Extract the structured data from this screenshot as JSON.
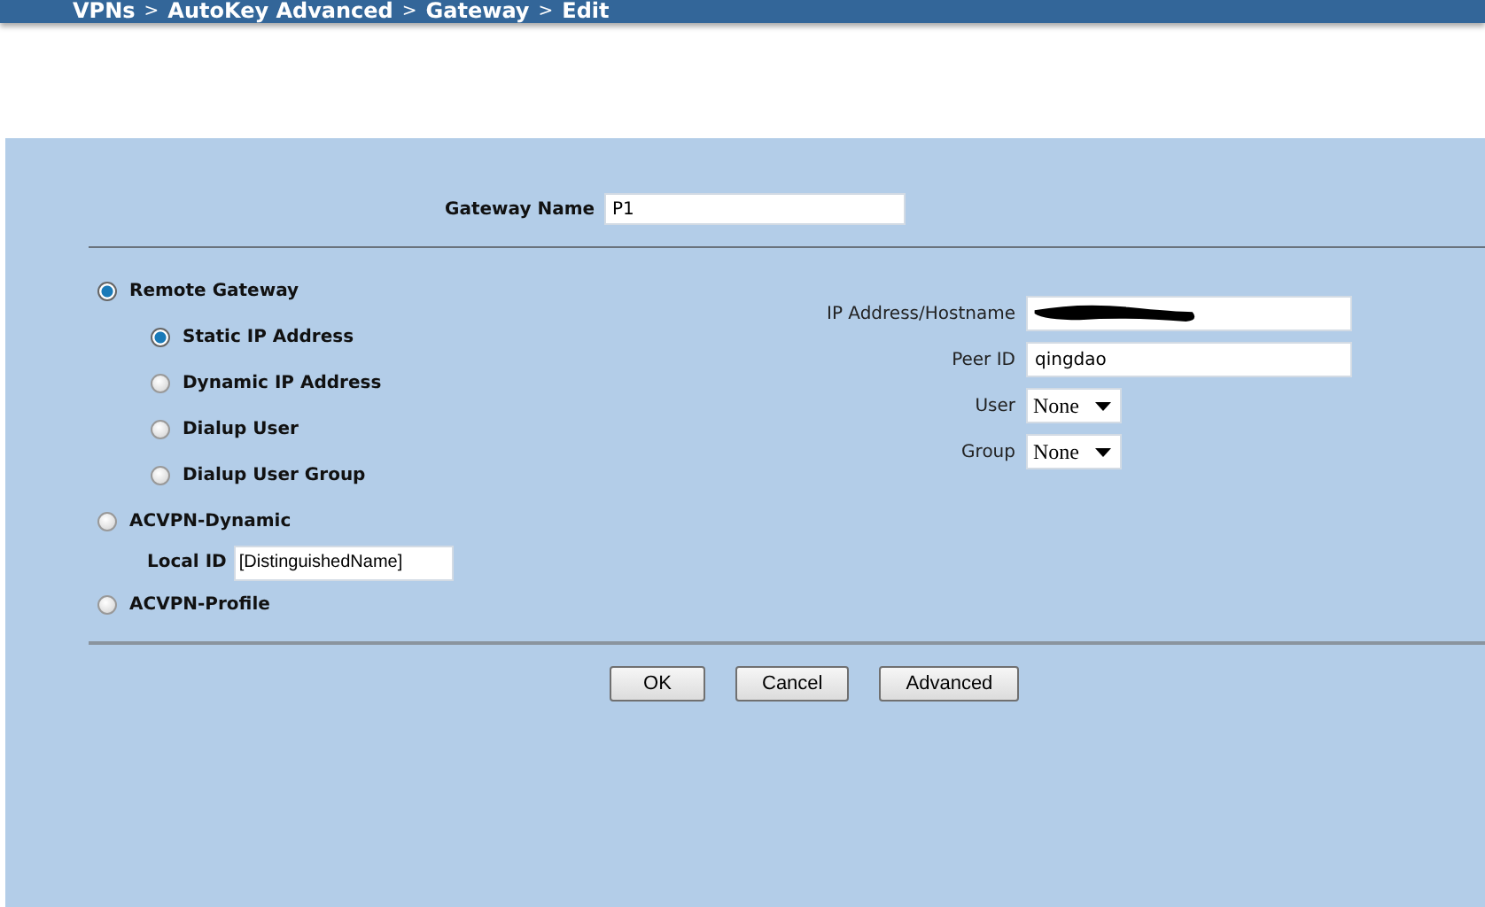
{
  "breadcrumb": {
    "items": [
      "VPNs",
      "AutoKey Advanced",
      "Gateway",
      "Edit"
    ],
    "separator": ">"
  },
  "gateway_name": {
    "label": "Gateway Name",
    "value": "P1"
  },
  "gateway_types": [
    {
      "label": "Remote Gateway",
      "selected": true,
      "options": [
        {
          "label": "Static IP Address",
          "selected": true
        },
        {
          "label": "Dynamic IP Address",
          "selected": false
        },
        {
          "label": "Dialup User",
          "selected": false
        },
        {
          "label": "Dialup User Group",
          "selected": false
        }
      ]
    },
    {
      "label": "ACVPN-Dynamic",
      "selected": false,
      "local_id": {
        "label": "Local ID",
        "value": "[DistinguishedName]"
      }
    },
    {
      "label": "ACVPN-Profile",
      "selected": false
    }
  ],
  "remote_fields": [
    {
      "label": "IP Address/Hostname",
      "kind": "redacted"
    },
    {
      "label": "Peer ID",
      "kind": "text",
      "value": "qingdao"
    },
    {
      "label": "User",
      "kind": "select",
      "value": "None"
    },
    {
      "label": "Group",
      "kind": "select",
      "value": "None"
    }
  ],
  "buttons": [
    "OK",
    "Cancel",
    "Advanced"
  ]
}
